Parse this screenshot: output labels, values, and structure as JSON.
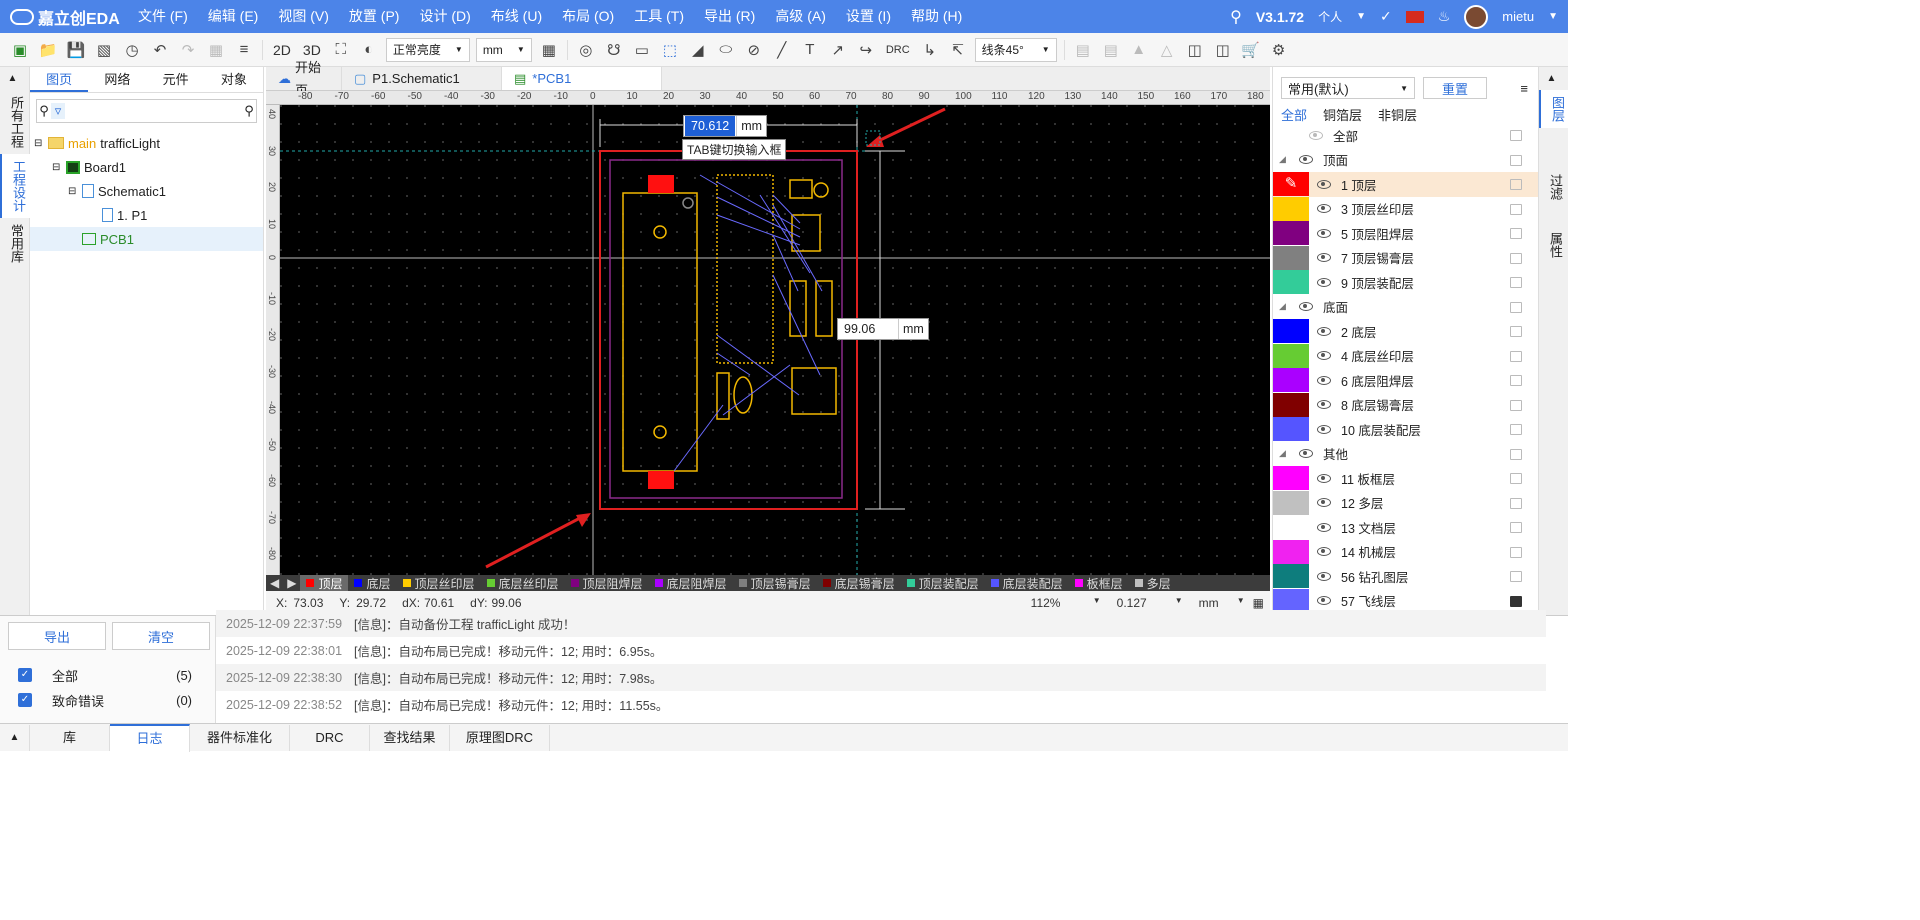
{
  "app": {
    "logo_text": "嘉立创EDA",
    "version": "V3.1.72",
    "account_type": "个人",
    "username": "mietu"
  },
  "menu": [
    "文件 (F)",
    "编辑 (E)",
    "视图 (V)",
    "放置 (P)",
    "设计 (D)",
    "布线 (U)",
    "布局 (O)",
    "工具 (T)",
    "导出 (R)",
    "高级 (A)",
    "设置 (I)",
    "帮助 (H)"
  ],
  "toolbar": {
    "view_2d": "2D",
    "view_3d": "3D",
    "brightness": "正常亮度",
    "unit": "mm",
    "routing_mode": "线条45°",
    "drc_label": "DRC"
  },
  "left_vtabs": [
    "所有工程",
    "工程设计",
    "常用库"
  ],
  "right_vtabs": [
    "图层",
    "过滤",
    "属性"
  ],
  "left_panel": {
    "tabs": [
      "图页",
      "网络",
      "元件",
      "对象"
    ],
    "search_placeholder": "",
    "tree": {
      "project_tag": "main",
      "project_name": "trafficLight",
      "board": "Board1",
      "schematic": "Schematic1",
      "page": "1. P1",
      "pcb": "PCB1"
    }
  },
  "doc_tabs": [
    "开始页",
    "P1.Schematic1",
    "*PCB1"
  ],
  "ruler": {
    "h_labels": [
      "-80",
      "-70",
      "-60",
      "-50",
      "-40",
      "-30",
      "-20",
      "-10",
      "0",
      "10",
      "20",
      "30",
      "40",
      "50",
      "60",
      "70",
      "80",
      "90",
      "100",
      "110",
      "120",
      "130",
      "140",
      "150",
      "160",
      "170",
      "180"
    ],
    "v_labels": [
      "40",
      "30",
      "20",
      "10",
      "0",
      "-10",
      "-20",
      "-30",
      "-40",
      "-50",
      "-60",
      "-70",
      "-80"
    ]
  },
  "canvas": {
    "width_value": "70.612",
    "height_value": "99.06",
    "unit": "mm",
    "tip": "TAB键切换输入框"
  },
  "layer_bar": [
    {
      "name": "顶层",
      "color": "#ff0000",
      "active": true
    },
    {
      "name": "底层",
      "color": "#0000ff"
    },
    {
      "name": "顶层丝印层",
      "color": "#ffcc00"
    },
    {
      "name": "底层丝印层",
      "color": "#66cc33"
    },
    {
      "name": "顶层阻焊层",
      "color": "#800080"
    },
    {
      "name": "底层阻焊层",
      "color": "#aa00ff"
    },
    {
      "name": "顶层锡膏层",
      "color": "#808080"
    },
    {
      "name": "底层锡膏层",
      "color": "#800000"
    },
    {
      "name": "顶层装配层",
      "color": "#33cc99"
    },
    {
      "name": "底层装配层",
      "color": "#5555ff"
    },
    {
      "name": "板框层",
      "color": "#ff00ff"
    },
    {
      "name": "多层",
      "color": "#c0c0c0"
    }
  ],
  "status": {
    "x_label": "X:",
    "x": "73.03",
    "y_label": "Y:",
    "y": "29.72",
    "dx_label": "dX:",
    "dx": "70.61",
    "dy_label": "dY:",
    "dy": "99.06",
    "zoom": "112%",
    "grid": "0.127",
    "unit": "mm"
  },
  "right_panel": {
    "preset": "常用(默认)",
    "reset": "重置",
    "filters": [
      "全部",
      "铜箔层",
      "非铜层"
    ],
    "all_label": "全部",
    "groups": {
      "top": "顶面",
      "bottom": "底面",
      "other": "其他"
    },
    "layers_top": [
      {
        "name": "1 顶层",
        "color": "#ff0000"
      },
      {
        "name": "3 顶层丝印层",
        "color": "#ffcc00"
      },
      {
        "name": "5 顶层阻焊层",
        "color": "#800080"
      },
      {
        "name": "7 顶层锡膏层",
        "color": "#808080"
      },
      {
        "name": "9 顶层装配层",
        "color": "#33cc99"
      }
    ],
    "layers_bottom": [
      {
        "name": "2 底层",
        "color": "#0000ff"
      },
      {
        "name": "4 底层丝印层",
        "color": "#66cc33"
      },
      {
        "name": "6 底层阻焊层",
        "color": "#aa00ff"
      },
      {
        "name": "8 底层锡膏层",
        "color": "#800000"
      },
      {
        "name": "10 底层装配层",
        "color": "#5555ff"
      }
    ],
    "layers_other": [
      {
        "name": "11 板框层",
        "color": "#ff00ff"
      },
      {
        "name": "12 多层",
        "color": "#c0c0c0"
      },
      {
        "name": "13 文档层",
        "color": "#ffffff"
      },
      {
        "name": "14 机械层",
        "color": "#f022f0"
      },
      {
        "name": "56 钻孔图层",
        "color": "#0e7d7d"
      },
      {
        "name": "57 飞线层",
        "color": "#6464ff"
      }
    ]
  },
  "log": {
    "export_btn": "导出",
    "clear_btn": "清空",
    "filters": [
      {
        "label": "全部",
        "count": "(5)"
      },
      {
        "label": "致命错误",
        "count": "(0)"
      }
    ],
    "rows": [
      {
        "time": "2025-12-09 22:37:59",
        "text": "[信息]：自动备份工程 trafficLight 成功！"
      },
      {
        "time": "2025-12-09 22:38:01",
        "text": "[信息]：自动布局已完成！移动元件：12; 用时：6.95s。"
      },
      {
        "time": "2025-12-09 22:38:30",
        "text": "[信息]：自动布局已完成！移动元件：12; 用时：7.98s。"
      },
      {
        "time": "2025-12-09 22:38:52",
        "text": "[信息]：自动布局已完成！移动元件：12; 用时：11.55s。"
      }
    ]
  },
  "bottom_tabs": [
    "库",
    "日志",
    "器件标准化",
    "DRC",
    "查找结果",
    "原理图DRC"
  ]
}
